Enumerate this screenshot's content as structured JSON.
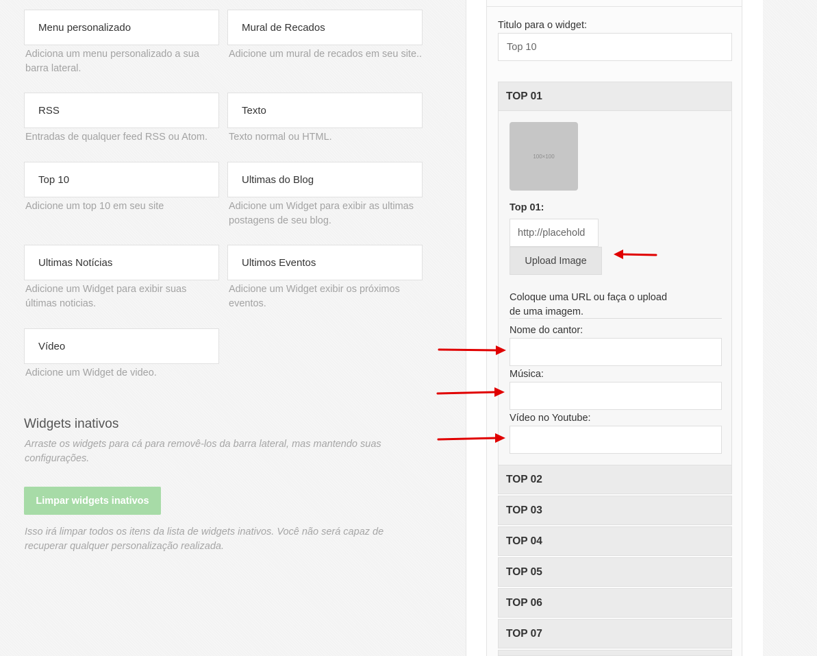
{
  "widgets": [
    {
      "title": "Menu personalizado",
      "desc": "Adiciona um menu personalizado a sua barra lateral."
    },
    {
      "title": "Mural de Recados",
      "desc": "Adicione um mural de recados em seu site.."
    },
    {
      "title": "RSS",
      "desc": "Entradas de qualquer feed RSS ou Atom."
    },
    {
      "title": "Texto",
      "desc": "Texto normal ou HTML."
    },
    {
      "title": "Top 10",
      "desc": "Adicione um top 10 em seu site"
    },
    {
      "title": "Ultimas do Blog",
      "desc": "Adicione um Widget para exibir as ultimas postagens de seu blog."
    },
    {
      "title": "Ultimas Notícias",
      "desc": "Adicione um Widget para exibir suas últimas noticias."
    },
    {
      "title": "Ultimos Eventos",
      "desc": "Adicione um Widget exibir os próximos eventos."
    },
    {
      "title": "Vídeo",
      "desc": "Adicione um Widget de video."
    }
  ],
  "inactive": {
    "title": "Widgets inativos",
    "desc": "Arraste os widgets para cá para removê-los da barra lateral, mas mantendo suas configurações.",
    "clear_label": "Limpar widgets inativos",
    "clear_desc": "Isso irá limpar todos os itens da lista de widgets inativos. Você não será capaz de recuperar qualquer personalização realizada."
  },
  "editor": {
    "title_label": "Titulo para o widget:",
    "title_value": "Top 10",
    "tops": [
      "TOP 01",
      "TOP 02",
      "TOP 03",
      "TOP 04",
      "TOP 05",
      "TOP 06",
      "TOP 07"
    ],
    "top01": {
      "thumb_text": "100×100",
      "image_label": "Top 01:",
      "image_url": "http://placehold",
      "upload_label": "Upload Image",
      "hint": "Coloque uma URL ou faça o upload de uma imagem.",
      "singer_label": "Nome do cantor:",
      "singer_value": "",
      "music_label": "Música:",
      "music_value": "",
      "video_label": "Vídeo no Youtube:",
      "video_value": ""
    }
  },
  "colors": {
    "accent_green": "#a7dba7",
    "arrow_red": "#e00000"
  }
}
